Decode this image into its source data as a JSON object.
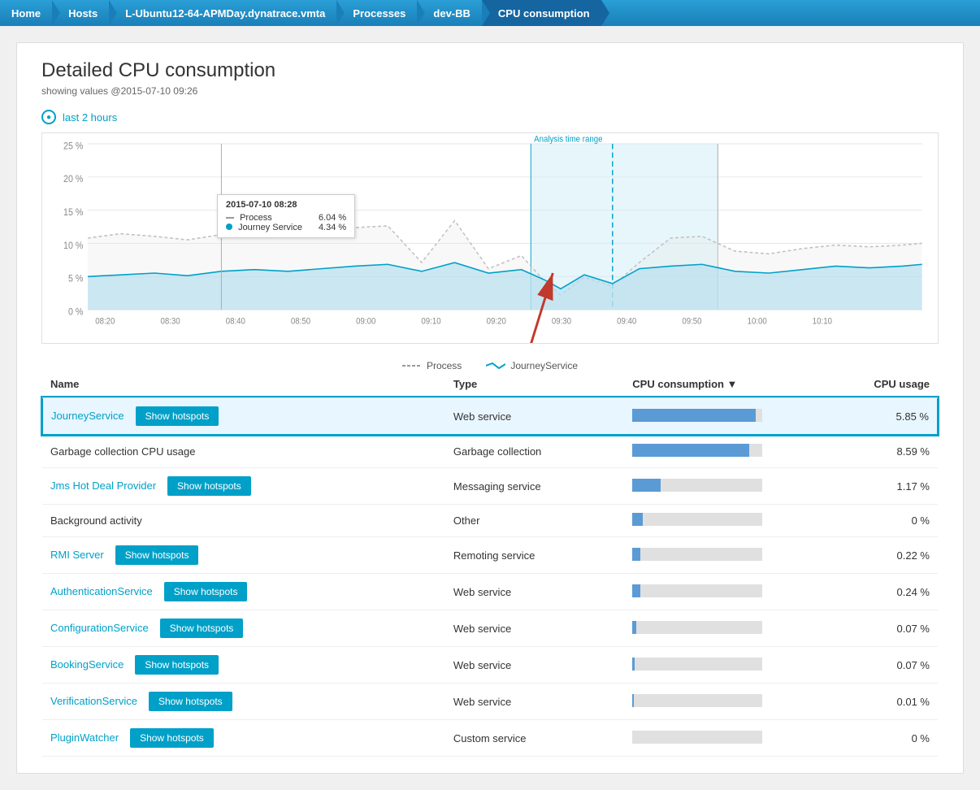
{
  "breadcrumb": {
    "items": [
      {
        "label": "Home",
        "id": "home"
      },
      {
        "label": "Hosts",
        "id": "hosts"
      },
      {
        "label": "L-Ubuntu12-64-APMDay.dynatrace.vmta",
        "id": "host"
      },
      {
        "label": "Processes",
        "id": "processes"
      },
      {
        "label": "dev-BB",
        "id": "devbb"
      },
      {
        "label": "CPU consumption",
        "id": "cpu"
      }
    ]
  },
  "page": {
    "title": "Detailed CPU consumption",
    "subtitle": "showing values @2015-07-10 09:26",
    "time_range_label": "last 2 hours"
  },
  "chart": {
    "y_labels": [
      "25 %",
      "20 %",
      "15 %",
      "10 %",
      "5 %",
      "0 %"
    ],
    "x_labels": [
      "08:20",
      "08:30",
      "08:40",
      "08:50",
      "09:00",
      "09:10",
      "09:20",
      "09:30",
      "09:40",
      "09:50",
      "10:00",
      "10:10"
    ],
    "analysis_label": "Analysis time range",
    "tooltip": {
      "date": "2015-07-10 08:28",
      "process_label": "Process",
      "process_value": "6.04 %",
      "journey_label": "Journey Service",
      "journey_value": "4.34 %"
    },
    "legend": {
      "process_label": "Process",
      "journey_label": "JourneyService"
    }
  },
  "table": {
    "headers": {
      "name": "Name",
      "type": "Type",
      "cpu_consumption": "CPU consumption ▼",
      "cpu_usage": "CPU usage"
    },
    "rows": [
      {
        "id": "journey",
        "name": "JourneyService",
        "is_link": true,
        "has_hotspots": true,
        "type": "Web service",
        "cpu_pct": 5.85,
        "bar_pct": 95,
        "bar_color": "#5b9bd5",
        "usage": "5.85 %",
        "highlighted": true
      },
      {
        "id": "gc",
        "name": "Garbage collection CPU usage",
        "is_link": false,
        "has_hotspots": false,
        "type": "Garbage collection",
        "cpu_pct": 8.59,
        "bar_pct": 90,
        "bar_color": "#5b9bd5",
        "usage": "8.59 %",
        "highlighted": false
      },
      {
        "id": "jms",
        "name": "Jms Hot Deal Provider",
        "is_link": true,
        "has_hotspots": true,
        "type": "Messaging service",
        "cpu_pct": 1.17,
        "bar_pct": 22,
        "bar_color": "#5b9bd5",
        "usage": "1.17 %",
        "highlighted": false
      },
      {
        "id": "bg",
        "name": "Background activity",
        "is_link": false,
        "has_hotspots": false,
        "type": "Other",
        "cpu_pct": 0,
        "bar_pct": 8,
        "bar_color": "#5b9bd5",
        "usage": "0 %",
        "highlighted": false
      },
      {
        "id": "rmi",
        "name": "RMI Server",
        "is_link": true,
        "has_hotspots": true,
        "type": "Remoting service",
        "cpu_pct": 0.22,
        "bar_pct": 6,
        "bar_color": "#5b9bd5",
        "usage": "0.22 %",
        "highlighted": false
      },
      {
        "id": "auth",
        "name": "AuthenticationService",
        "is_link": true,
        "has_hotspots": true,
        "type": "Web service",
        "cpu_pct": 0.24,
        "bar_pct": 6,
        "bar_color": "#5b9bd5",
        "usage": "0.24 %",
        "highlighted": false
      },
      {
        "id": "config",
        "name": "ConfigurationService",
        "is_link": true,
        "has_hotspots": true,
        "type": "Web service",
        "cpu_pct": 0.07,
        "bar_pct": 3,
        "bar_color": "#5b9bd5",
        "usage": "0.07 %",
        "highlighted": false
      },
      {
        "id": "booking",
        "name": "BookingService",
        "is_link": true,
        "has_hotspots": true,
        "type": "Web service",
        "cpu_pct": 0.07,
        "bar_pct": 2,
        "bar_color": "#5b9bd5",
        "usage": "0.07 %",
        "highlighted": false
      },
      {
        "id": "verify",
        "name": "VerificationService",
        "is_link": true,
        "has_hotspots": true,
        "type": "Web service",
        "cpu_pct": 0.01,
        "bar_pct": 1,
        "bar_color": "#5b9bd5",
        "usage": "0.01 %",
        "highlighted": false
      },
      {
        "id": "plugin",
        "name": "PluginWatcher",
        "is_link": true,
        "has_hotspots": true,
        "type": "Custom service",
        "cpu_pct": 0,
        "bar_pct": 0,
        "bar_color": "#5b9bd5",
        "usage": "0 %",
        "highlighted": false
      }
    ]
  },
  "buttons": {
    "show_hotspots": "Show hotspots"
  }
}
